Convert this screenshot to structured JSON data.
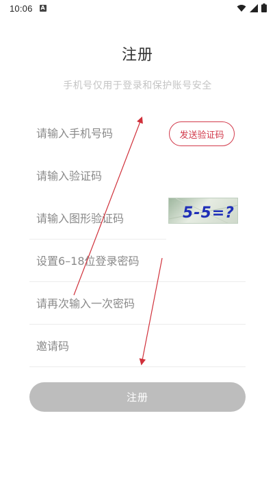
{
  "status_bar": {
    "time": "10:06",
    "notification_badge": "A"
  },
  "header": {
    "title": "注册",
    "subtitle": "手机号仅用于登录和保护账号安全"
  },
  "form": {
    "phone": {
      "placeholder": "请输入手机号码",
      "value": ""
    },
    "send_code_label": "发送验证码",
    "sms_code": {
      "placeholder": "请输入验证码",
      "value": ""
    },
    "captcha_input": {
      "placeholder": "请输入图形验证码",
      "value": ""
    },
    "captcha_image_text": "5-5=?",
    "password": {
      "placeholder": "设置6–18位登录密码",
      "value": ""
    },
    "confirm_password": {
      "placeholder": "请再次输入一次密码",
      "value": ""
    },
    "invite_code": {
      "placeholder": "邀请码",
      "value": ""
    },
    "submit_label": "注册"
  },
  "colors": {
    "accent": "#d23a4b",
    "button_disabled": "#bdbdbd",
    "annotation_arrow": "#d0303a",
    "captcha_text": "#1f2fb8"
  }
}
